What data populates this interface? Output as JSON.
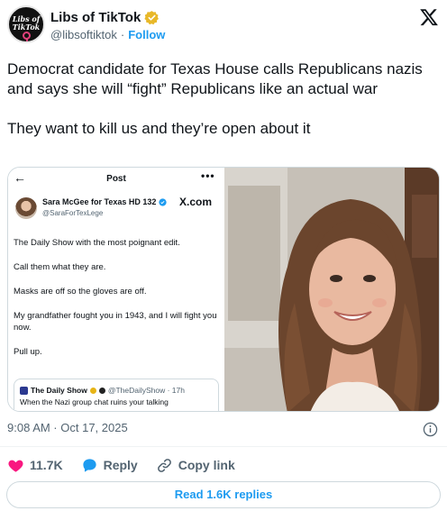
{
  "account": {
    "display_name": "Libs of TikTok",
    "handle": "@libsoftiktok",
    "separator": "·",
    "follow_label": "Follow",
    "avatar_line1": "Libs of",
    "avatar_line2": "TikTok"
  },
  "tweet": {
    "paragraph1": "Democrat candidate for Texas House calls Republicans nazis and says she will “fight” Republicans like an actual war",
    "paragraph2": "They want to kill us and they’re open about it"
  },
  "embedded_screenshot": {
    "back_icon": "←",
    "title": "Post",
    "more_icon": "•••",
    "author_name": "Sara McGee for Texas HD 132",
    "author_handle": "@SaraForTexLege",
    "xcom_label": "X.com",
    "lines": [
      "The Daily Show with the most poignant edit.",
      "Call them what they are.",
      "Masks are off so the gloves are off.",
      "My grandfather fought you in 1943, and I will fight you now.",
      "Pull up."
    ],
    "quote": {
      "name": "The Daily Show",
      "handle_time": "@TheDailyShow · 17h",
      "text": "When the Nazi group chat ruins your talking"
    }
  },
  "meta": {
    "timestamp": "9:08 AM · Oct 17, 2025"
  },
  "actions": {
    "likes": "11.7K",
    "reply_label": "Reply",
    "copy_link_label": "Copy link"
  },
  "replies_button": "Read 1.6K replies",
  "colors": {
    "accent": "#1d9bf0",
    "like": "#f91880",
    "verified_gold": "#e8b829",
    "text_secondary": "#536471"
  },
  "icons": [
    "verified-gold-badge-icon",
    "x-logo-icon",
    "info-icon",
    "heart-icon",
    "reply-bubble-icon",
    "link-icon"
  ]
}
